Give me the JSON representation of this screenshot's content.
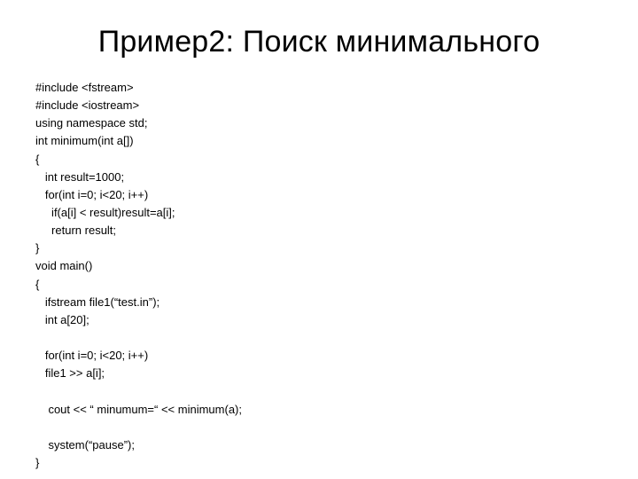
{
  "title": "Пример2: Поиск минимального",
  "code": "#include <fstream>\n#include <iostream>\nusing namespace std;\nint minimum(int a[])\n{\n   int result=1000;\n   for(int i=0; i<20; i++)\n     if(a[i] < result)result=a[i];\n     return result;\n}\nvoid main()\n{\n   ifstream file1(“test.in”);\n   int a[20];\n\n   for(int i=0; i<20; i++)\n   file1 >> a[i];\n\n    cout << “ minumum=“ << minimum(a);\n\n    system(“pause”);\n}"
}
